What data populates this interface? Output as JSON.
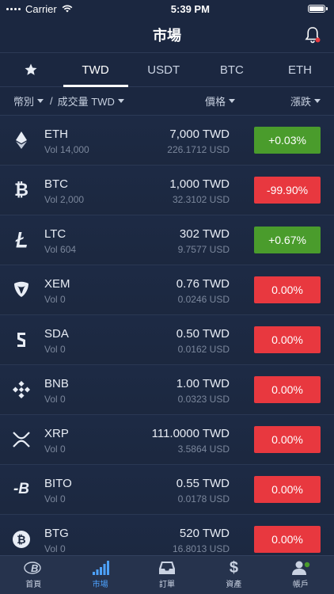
{
  "status": {
    "carrier": "Carrier",
    "time": "5:39 PM"
  },
  "header": {
    "title": "市場"
  },
  "tabs": [
    "TWD",
    "USDT",
    "BTC",
    "ETH"
  ],
  "sort": {
    "currency": "幣別",
    "separator": "/",
    "volume": "成交量 TWD",
    "price": "價格",
    "change": "漲跌"
  },
  "rows": [
    {
      "symbol": "ETH",
      "vol": "Vol 14,000",
      "price": "7,000 TWD",
      "usd": "226.1712 USD",
      "change": "+0.03%",
      "dir": "up",
      "icon": "eth-icon"
    },
    {
      "symbol": "BTC",
      "vol": "Vol 2,000",
      "price": "1,000 TWD",
      "usd": "32.3102 USD",
      "change": "-99.90%",
      "dir": "down",
      "icon": "btc-icon"
    },
    {
      "symbol": "LTC",
      "vol": "Vol 604",
      "price": "302 TWD",
      "usd": "9.7577 USD",
      "change": "+0.67%",
      "dir": "up",
      "icon": "ltc-icon"
    },
    {
      "symbol": "XEM",
      "vol": "Vol 0",
      "price": "0.76 TWD",
      "usd": "0.0246 USD",
      "change": "0.00%",
      "dir": "down",
      "icon": "xem-icon"
    },
    {
      "symbol": "SDA",
      "vol": "Vol 0",
      "price": "0.50 TWD",
      "usd": "0.0162 USD",
      "change": "0.00%",
      "dir": "down",
      "icon": "sda-icon"
    },
    {
      "symbol": "BNB",
      "vol": "Vol 0",
      "price": "1.00 TWD",
      "usd": "0.0323 USD",
      "change": "0.00%",
      "dir": "down",
      "icon": "bnb-icon"
    },
    {
      "symbol": "XRP",
      "vol": "Vol 0",
      "price": "111.0000 TWD",
      "usd": "3.5864 USD",
      "change": "0.00%",
      "dir": "down",
      "icon": "xrp-icon"
    },
    {
      "symbol": "BITO",
      "vol": "Vol 0",
      "price": "0.55 TWD",
      "usd": "0.0178 USD",
      "change": "0.00%",
      "dir": "down",
      "icon": "bito-icon"
    },
    {
      "symbol": "BTG",
      "vol": "Vol 0",
      "price": "520 TWD",
      "usd": "16.8013 USD",
      "change": "0.00%",
      "dir": "down",
      "icon": "btg-icon"
    }
  ],
  "bottom_nav": [
    {
      "label": "首頁",
      "icon": "home-logo-icon"
    },
    {
      "label": "市場",
      "icon": "market-bars-icon",
      "active": true
    },
    {
      "label": "訂單",
      "icon": "inbox-icon"
    },
    {
      "label": "資產",
      "icon": "dollar-icon"
    },
    {
      "label": "帳戶",
      "icon": "account-icon"
    }
  ],
  "colors": {
    "up": "#4a9c2c",
    "down": "#e8383f",
    "accent": "#4da3ff",
    "background": "#1b2740"
  }
}
